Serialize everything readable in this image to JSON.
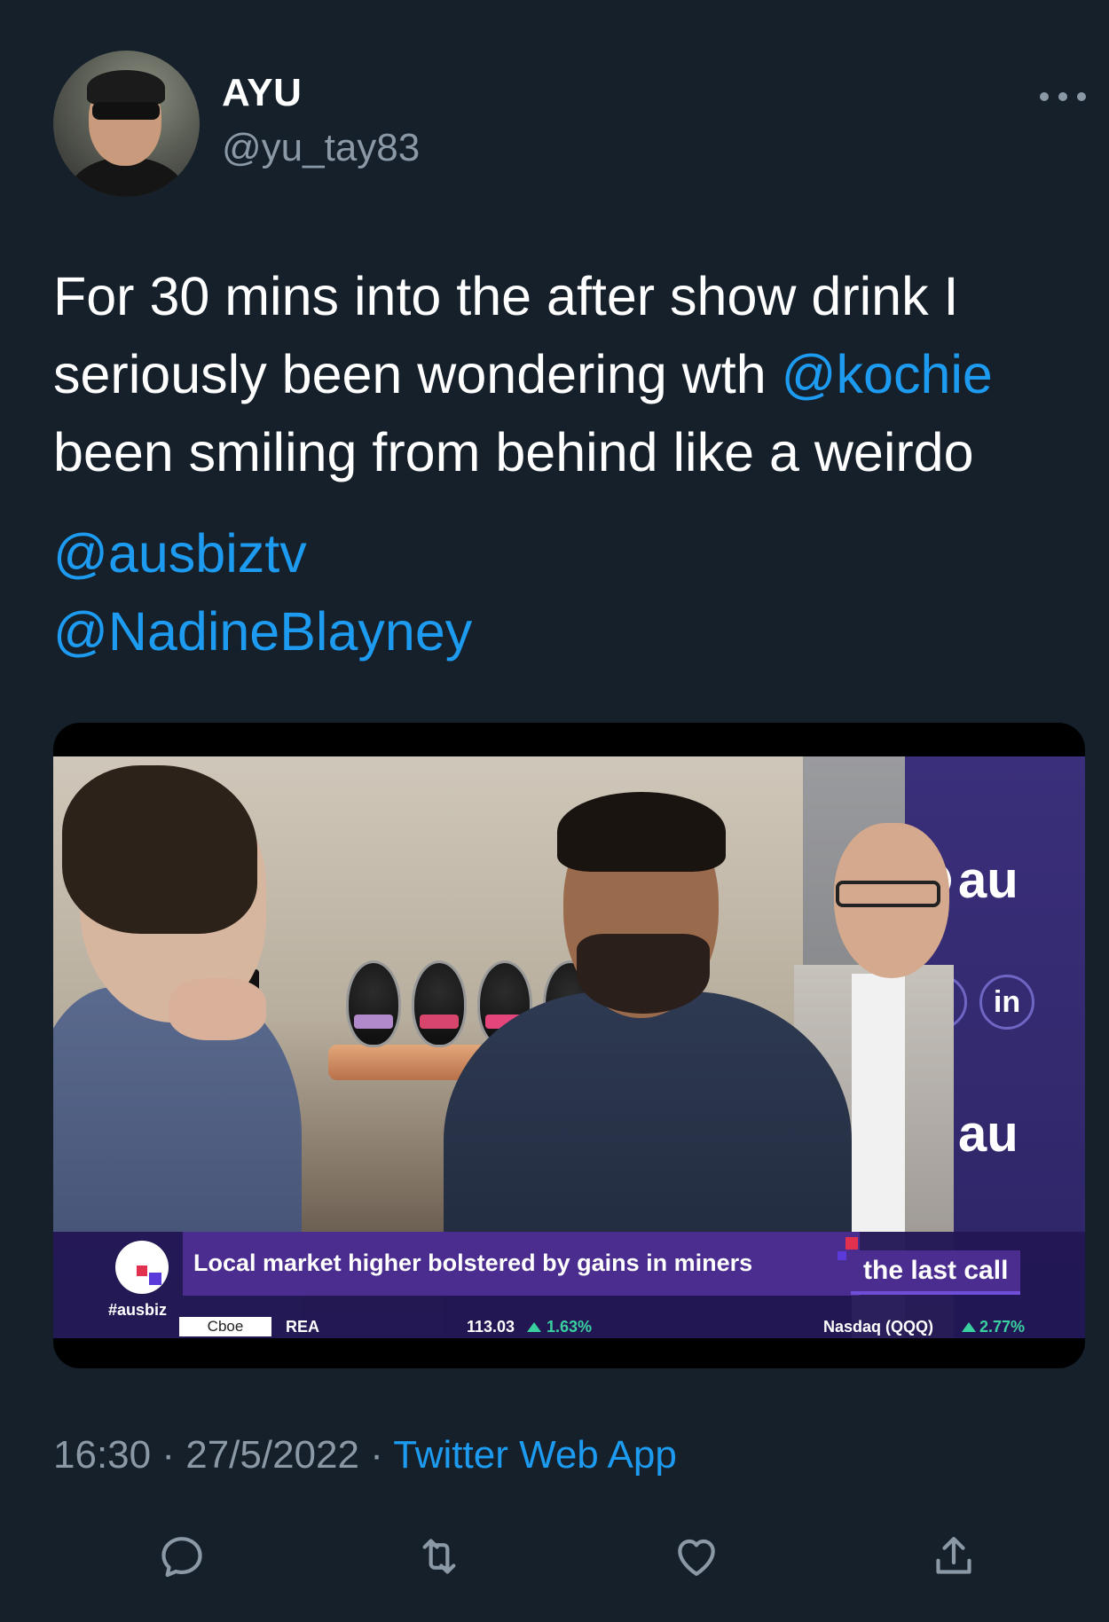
{
  "author": {
    "display_name": "AYU",
    "handle": "@yu_tay83"
  },
  "tweet": {
    "text_lines": [
      "For 30 mins into the after show drink I",
      "seriously been wondering wth ",
      "been smiling from behind like a weirdo"
    ],
    "inline_mention": "@kochie",
    "mentions": [
      "@ausbiztv",
      "@NadineBlayney"
    ]
  },
  "media": {
    "backdrop_text_1": "au",
    "backdrop_text_2": "au",
    "backdrop_social_2": "in",
    "lower_third": {
      "headline": "Local market higher bolstered by gains in miners",
      "hashtag": "#ausbiz",
      "segment": "the last call",
      "ticker": {
        "exchange": "Cboe",
        "symbol": "REA",
        "price": "113.03",
        "change": "1.63%",
        "index": "Nasdaq (QQQ)",
        "index_change": "2.77%"
      }
    }
  },
  "meta": {
    "time": "16:30",
    "date": "27/5/2022",
    "separator": " · ",
    "source": "Twitter Web App"
  },
  "icons": {
    "reply": "reply-icon",
    "retweet": "retweet-icon",
    "like": "like-icon",
    "share": "share-icon",
    "more": "more-icon"
  },
  "colors": {
    "background": "#15202b",
    "link": "#1d9bf0",
    "secondary_text": "#8b98a5"
  }
}
